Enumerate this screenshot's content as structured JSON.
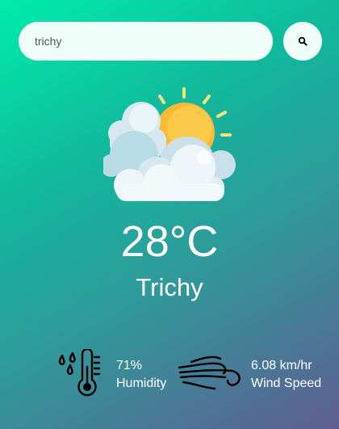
{
  "search": {
    "value": "trichy",
    "button_icon": "search-icon"
  },
  "weather": {
    "icon": "sun-behind-clouds-icon",
    "temperature": "28°C",
    "city": "Trichy"
  },
  "humidity": {
    "icon": "thermometer-droplets-icon",
    "value": "71%",
    "label": "Humidity"
  },
  "wind": {
    "icon": "wind-icon",
    "value": "6.08 km/hr",
    "label": "Wind Speed"
  },
  "colors": {
    "gradient_top": "#00ecaa",
    "gradient_bottom": "#5f5d92",
    "input_background": "#eefdf8",
    "sun": "#fbc02d"
  }
}
